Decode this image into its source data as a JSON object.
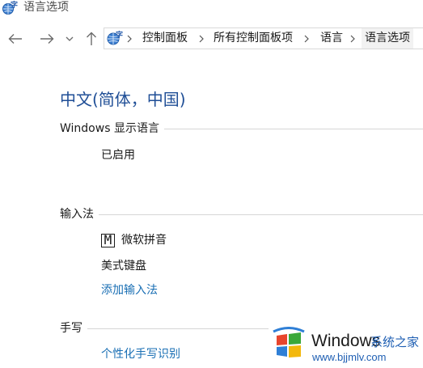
{
  "window": {
    "title": "语言选项",
    "icon": "language-settings-icon"
  },
  "nav": {
    "back_icon": "arrow-left-icon",
    "forward_icon": "arrow-right-icon",
    "recent_icon": "chevron-down-icon",
    "up_icon": "arrow-up-icon"
  },
  "breadcrumb": {
    "icon": "control-panel-icon",
    "items": [
      {
        "label": "控制面板"
      },
      {
        "label": "所有控制面板项"
      },
      {
        "label": "语言"
      },
      {
        "label": "语言选项"
      }
    ],
    "separator_icon": "chevron-right-icon"
  },
  "main": {
    "language_title": "中文(简体，中国)",
    "display_language": {
      "header": "Windows 显示语言",
      "status": "已启用"
    },
    "input_method": {
      "header": "输入法",
      "ime_icon_glyph": "M",
      "ime_name": "微软拼音",
      "keyboard": "美式键盘",
      "add_link": "添加输入法"
    },
    "handwriting": {
      "header": "手写",
      "link": "个性化手写识别"
    }
  },
  "watermark": {
    "brand": "Windows",
    "brand_cn": "系统之家",
    "url": "www.bjjmlv.com"
  },
  "colors": {
    "title_blue": "#1f4e96",
    "link_blue": "#1a6fb4",
    "rule_gray": "#d6d6d6"
  }
}
